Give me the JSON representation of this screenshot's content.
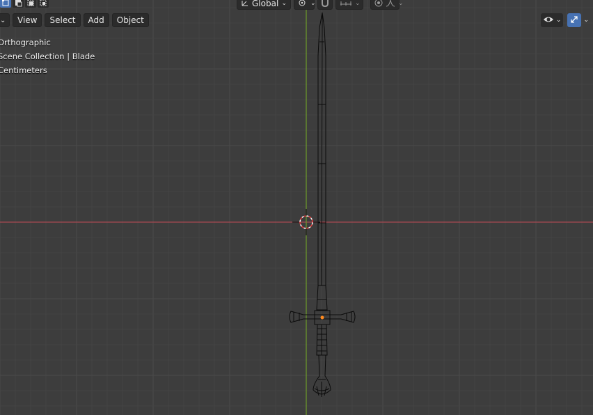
{
  "header": {
    "menus": [
      {
        "label": "View"
      },
      {
        "label": "Select"
      },
      {
        "label": "Add"
      },
      {
        "label": "Object"
      }
    ]
  },
  "toolbar": {
    "transform_orientation": "Global",
    "select_modes": [
      "vertex-select-icon",
      "edge-select-icon",
      "face-select-icon",
      "all-select-icon"
    ]
  },
  "overlay": {
    "view_mode": "Orthographic",
    "collection": "Scene Collection | Blade",
    "units": "Centimeters"
  },
  "colors": {
    "background": "#3d3d3d",
    "grid_minor": "#444444",
    "grid_major": "#4a4a4a",
    "x_axis": "#a84a52",
    "y_axis": "#6e9c2a",
    "wire": "#0a0a0a",
    "accent": "#4772b3"
  }
}
